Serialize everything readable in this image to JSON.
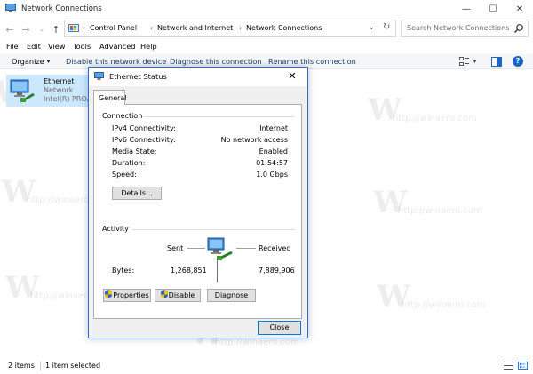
{
  "window": {
    "title": "Network Connections",
    "caption": {
      "minimize": "—",
      "maximize": "☐",
      "close": "✕"
    }
  },
  "nav": {
    "back": "←",
    "forward": "→",
    "recent": "⌄",
    "up": "↑",
    "breadcrumb": [
      "Control Panel",
      "Network and Internet",
      "Network Connections"
    ],
    "separator": "›",
    "dropdown": "⌄",
    "refresh": "↻"
  },
  "search": {
    "placeholder": "Search Network Connections"
  },
  "menu": [
    "File",
    "Edit",
    "View",
    "Tools",
    "Advanced",
    "Help"
  ],
  "commands": {
    "organize": "Organize",
    "organize_arrow": "▾",
    "disable": "Disable this network device",
    "diagnose": "Diagnose this connection",
    "rename": "Rename this connection",
    "view_arrow": "▾",
    "help": "?"
  },
  "items": [
    {
      "name": "Ethernet",
      "type": "Network",
      "adapter": "Intel(R) PRO/1000 MT Desktop Adapter"
    }
  ],
  "watermark": {
    "glyph": "W",
    "text": "http://winaero.com"
  },
  "status": {
    "items": "2 items",
    "selected": "1 item selected"
  },
  "dialog": {
    "title": "Ethernet Status",
    "close": "✕",
    "tab": "General",
    "connection": {
      "group": "Connection",
      "rows": [
        {
          "label": "IPv4 Connectivity:",
          "value": "Internet"
        },
        {
          "label": "IPv6 Connectivity:",
          "value": "No network access"
        },
        {
          "label": "Media State:",
          "value": "Enabled"
        },
        {
          "label": "Duration:",
          "value": "01:54:57"
        },
        {
          "label": "Speed:",
          "value": "1.0 Gbps"
        }
      ],
      "details_button": "Details..."
    },
    "activity": {
      "group": "Activity",
      "sent_label": "Sent",
      "received_label": "Received",
      "bytes_label": "Bytes:",
      "sent": "1,268,851",
      "received": "7,889,906"
    },
    "buttons": {
      "properties": "Properties",
      "disable": "Disable",
      "diagnose": "Diagnose",
      "close": "Close"
    }
  }
}
